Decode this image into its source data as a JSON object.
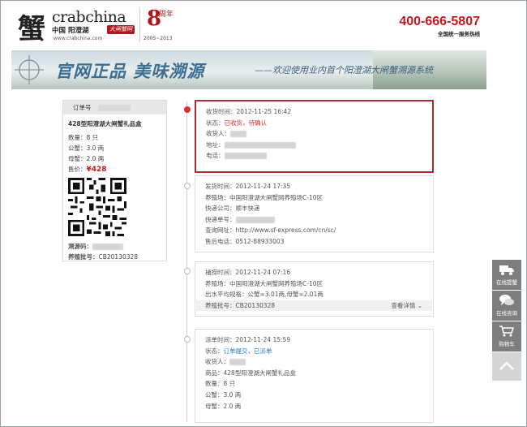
{
  "header": {
    "logo_char": "蟹",
    "brand": "crabchina",
    "brand_cn": "中国 阳澄湖",
    "brand_tag": "大闸蟹网",
    "brand_url": "www.crabchina.com",
    "anniv_num": "8",
    "anniv_sub": "周年",
    "anniv_years": "2005~2013",
    "hotline": "400-666-5807",
    "hotline_sub": "全国统一服务热线"
  },
  "banner": {
    "title": "官网正品 美味溯源",
    "subtitle": "——欢迎使用业内首个阳澄湖大闸蟹溯源系统"
  },
  "order": {
    "header": "订单号",
    "product": "428型阳澄湖大闸蟹礼品盒",
    "rows": [
      {
        "label": "数量：",
        "value": "8 只"
      },
      {
        "label": "公蟹：",
        "value": "3.0 两"
      },
      {
        "label": "母蟹：",
        "value": "2.0 两"
      }
    ],
    "price_label": "售价：",
    "price": "¥428",
    "trace_label": "溯源码：",
    "batch_label": "养殖批号：",
    "batch": "CB20130328"
  },
  "timeline": [
    {
      "rows": [
        {
          "label": "收货时间：",
          "value": "2012-11-25 16:42"
        },
        {
          "label": "状态：",
          "value": "已收货，待确认",
          "style": "status"
        },
        {
          "label": "收货人：",
          "blur": 20
        },
        {
          "label": "地址：",
          "blur": 88
        },
        {
          "label": "电话：",
          "blur": 52
        }
      ]
    },
    {
      "rows": [
        {
          "label": "发货时间：",
          "value": "2012-11-24 17:35"
        },
        {
          "label": "养殖场：",
          "value": "中国阳澄湖大闸蟹网养殖场C-10区"
        },
        {
          "label": "快递公司：",
          "value": "顺丰快递"
        },
        {
          "label": "快递单号：",
          "blur": 48
        },
        {
          "label": "查询网址：",
          "value": "http://www.sf-express.com/cn/sc/"
        },
        {
          "label": "售后电话：",
          "value": "0512-88933003"
        }
      ]
    },
    {
      "rows": [
        {
          "label": "捕捞时间：",
          "value": "2012-11-24 07:16"
        },
        {
          "label": "养殖场：",
          "value": "中国阳澄湖大闸蟹网养殖场C-10区"
        },
        {
          "label": "出水平均规格：",
          "value": "公蟹≈3.01两,母蟹≈2.01两"
        },
        {
          "label": "养殖批号：",
          "value": "CB20130328"
        }
      ],
      "more": "查看详情 ⌄"
    },
    {
      "rows": [
        {
          "label": "派单时间：",
          "value": "2012-11-24 15:59"
        },
        {
          "label": "状态：",
          "value": "订单提交，已派单",
          "style": "status-blue"
        },
        {
          "label": "收货人：",
          "blur": 20
        },
        {
          "label": "商品：",
          "value": "428型阳澄湖大闸蟹礼品盒"
        },
        {
          "label": "数量：",
          "value": "8 只"
        },
        {
          "label": "公蟹：",
          "value": "3.0 两"
        },
        {
          "label": "母蟹：",
          "value": "2.0 两"
        }
      ]
    }
  ],
  "side_tools": [
    {
      "label": "在线提蟹",
      "icon": "truck-icon"
    },
    {
      "label": "在线咨询",
      "icon": "chat-icon"
    },
    {
      "label": "购物车",
      "icon": "cart-icon"
    }
  ]
}
